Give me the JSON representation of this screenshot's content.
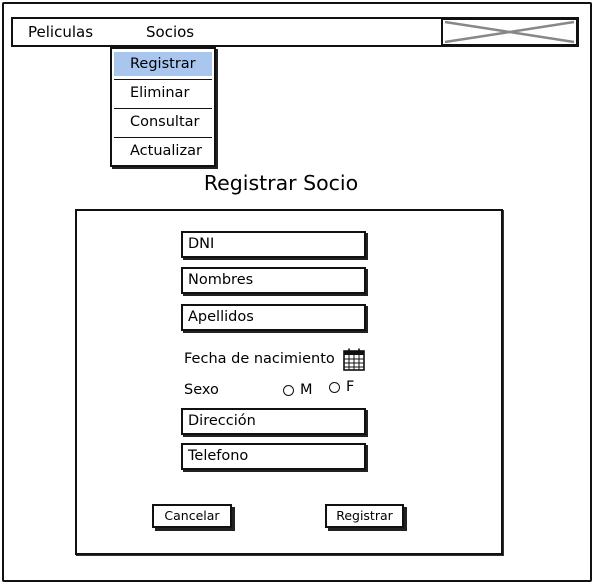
{
  "menu": {
    "items": [
      "Peliculas",
      "Socios"
    ]
  },
  "dropdown": {
    "items": [
      "Registrar",
      "Eliminar",
      "Consultar",
      "Actualizar"
    ],
    "selected_index": 0,
    "selected_color": "#a9c7ee"
  },
  "page": {
    "title": "Registrar Socio"
  },
  "form": {
    "dni_placeholder": "DNI",
    "nombres_placeholder": "Nombres",
    "apellidos_placeholder": "Apellidos",
    "fecha_label": "Fecha de nacimiento",
    "sexo_label": "Sexo",
    "sexo_options": [
      "M",
      "F"
    ],
    "direccion_placeholder": "Dirección",
    "telefono_placeholder": "Telefono"
  },
  "buttons": {
    "cancel": "Cancelar",
    "submit": "Registrar"
  },
  "icons": {
    "logo": "image-placeholder-icon",
    "date": "calendar-icon"
  }
}
